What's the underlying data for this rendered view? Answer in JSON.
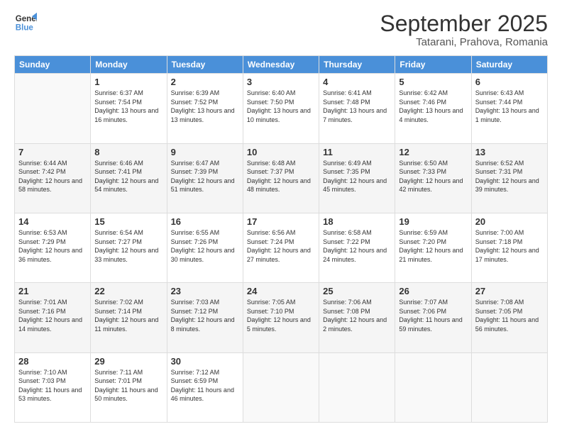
{
  "header": {
    "logo_line1": "General",
    "logo_line2": "Blue",
    "title": "September 2025",
    "subtitle": "Tatarani, Prahova, Romania"
  },
  "days_of_week": [
    "Sunday",
    "Monday",
    "Tuesday",
    "Wednesday",
    "Thursday",
    "Friday",
    "Saturday"
  ],
  "weeks": [
    [
      {
        "day": "",
        "info": ""
      },
      {
        "day": "1",
        "info": "Sunrise: 6:37 AM\nSunset: 7:54 PM\nDaylight: 13 hours\nand 16 minutes."
      },
      {
        "day": "2",
        "info": "Sunrise: 6:39 AM\nSunset: 7:52 PM\nDaylight: 13 hours\nand 13 minutes."
      },
      {
        "day": "3",
        "info": "Sunrise: 6:40 AM\nSunset: 7:50 PM\nDaylight: 13 hours\nand 10 minutes."
      },
      {
        "day": "4",
        "info": "Sunrise: 6:41 AM\nSunset: 7:48 PM\nDaylight: 13 hours\nand 7 minutes."
      },
      {
        "day": "5",
        "info": "Sunrise: 6:42 AM\nSunset: 7:46 PM\nDaylight: 13 hours\nand 4 minutes."
      },
      {
        "day": "6",
        "info": "Sunrise: 6:43 AM\nSunset: 7:44 PM\nDaylight: 13 hours\nand 1 minute."
      }
    ],
    [
      {
        "day": "7",
        "info": "Sunrise: 6:44 AM\nSunset: 7:42 PM\nDaylight: 12 hours\nand 58 minutes."
      },
      {
        "day": "8",
        "info": "Sunrise: 6:46 AM\nSunset: 7:41 PM\nDaylight: 12 hours\nand 54 minutes."
      },
      {
        "day": "9",
        "info": "Sunrise: 6:47 AM\nSunset: 7:39 PM\nDaylight: 12 hours\nand 51 minutes."
      },
      {
        "day": "10",
        "info": "Sunrise: 6:48 AM\nSunset: 7:37 PM\nDaylight: 12 hours\nand 48 minutes."
      },
      {
        "day": "11",
        "info": "Sunrise: 6:49 AM\nSunset: 7:35 PM\nDaylight: 12 hours\nand 45 minutes."
      },
      {
        "day": "12",
        "info": "Sunrise: 6:50 AM\nSunset: 7:33 PM\nDaylight: 12 hours\nand 42 minutes."
      },
      {
        "day": "13",
        "info": "Sunrise: 6:52 AM\nSunset: 7:31 PM\nDaylight: 12 hours\nand 39 minutes."
      }
    ],
    [
      {
        "day": "14",
        "info": "Sunrise: 6:53 AM\nSunset: 7:29 PM\nDaylight: 12 hours\nand 36 minutes."
      },
      {
        "day": "15",
        "info": "Sunrise: 6:54 AM\nSunset: 7:27 PM\nDaylight: 12 hours\nand 33 minutes."
      },
      {
        "day": "16",
        "info": "Sunrise: 6:55 AM\nSunset: 7:26 PM\nDaylight: 12 hours\nand 30 minutes."
      },
      {
        "day": "17",
        "info": "Sunrise: 6:56 AM\nSunset: 7:24 PM\nDaylight: 12 hours\nand 27 minutes."
      },
      {
        "day": "18",
        "info": "Sunrise: 6:58 AM\nSunset: 7:22 PM\nDaylight: 12 hours\nand 24 minutes."
      },
      {
        "day": "19",
        "info": "Sunrise: 6:59 AM\nSunset: 7:20 PM\nDaylight: 12 hours\nand 21 minutes."
      },
      {
        "day": "20",
        "info": "Sunrise: 7:00 AM\nSunset: 7:18 PM\nDaylight: 12 hours\nand 17 minutes."
      }
    ],
    [
      {
        "day": "21",
        "info": "Sunrise: 7:01 AM\nSunset: 7:16 PM\nDaylight: 12 hours\nand 14 minutes."
      },
      {
        "day": "22",
        "info": "Sunrise: 7:02 AM\nSunset: 7:14 PM\nDaylight: 12 hours\nand 11 minutes."
      },
      {
        "day": "23",
        "info": "Sunrise: 7:03 AM\nSunset: 7:12 PM\nDaylight: 12 hours\nand 8 minutes."
      },
      {
        "day": "24",
        "info": "Sunrise: 7:05 AM\nSunset: 7:10 PM\nDaylight: 12 hours\nand 5 minutes."
      },
      {
        "day": "25",
        "info": "Sunrise: 7:06 AM\nSunset: 7:08 PM\nDaylight: 12 hours\nand 2 minutes."
      },
      {
        "day": "26",
        "info": "Sunrise: 7:07 AM\nSunset: 7:06 PM\nDaylight: 11 hours\nand 59 minutes."
      },
      {
        "day": "27",
        "info": "Sunrise: 7:08 AM\nSunset: 7:05 PM\nDaylight: 11 hours\nand 56 minutes."
      }
    ],
    [
      {
        "day": "28",
        "info": "Sunrise: 7:10 AM\nSunset: 7:03 PM\nDaylight: 11 hours\nand 53 minutes."
      },
      {
        "day": "29",
        "info": "Sunrise: 7:11 AM\nSunset: 7:01 PM\nDaylight: 11 hours\nand 50 minutes."
      },
      {
        "day": "30",
        "info": "Sunrise: 7:12 AM\nSunset: 6:59 PM\nDaylight: 11 hours\nand 46 minutes."
      },
      {
        "day": "",
        "info": ""
      },
      {
        "day": "",
        "info": ""
      },
      {
        "day": "",
        "info": ""
      },
      {
        "day": "",
        "info": ""
      }
    ]
  ]
}
